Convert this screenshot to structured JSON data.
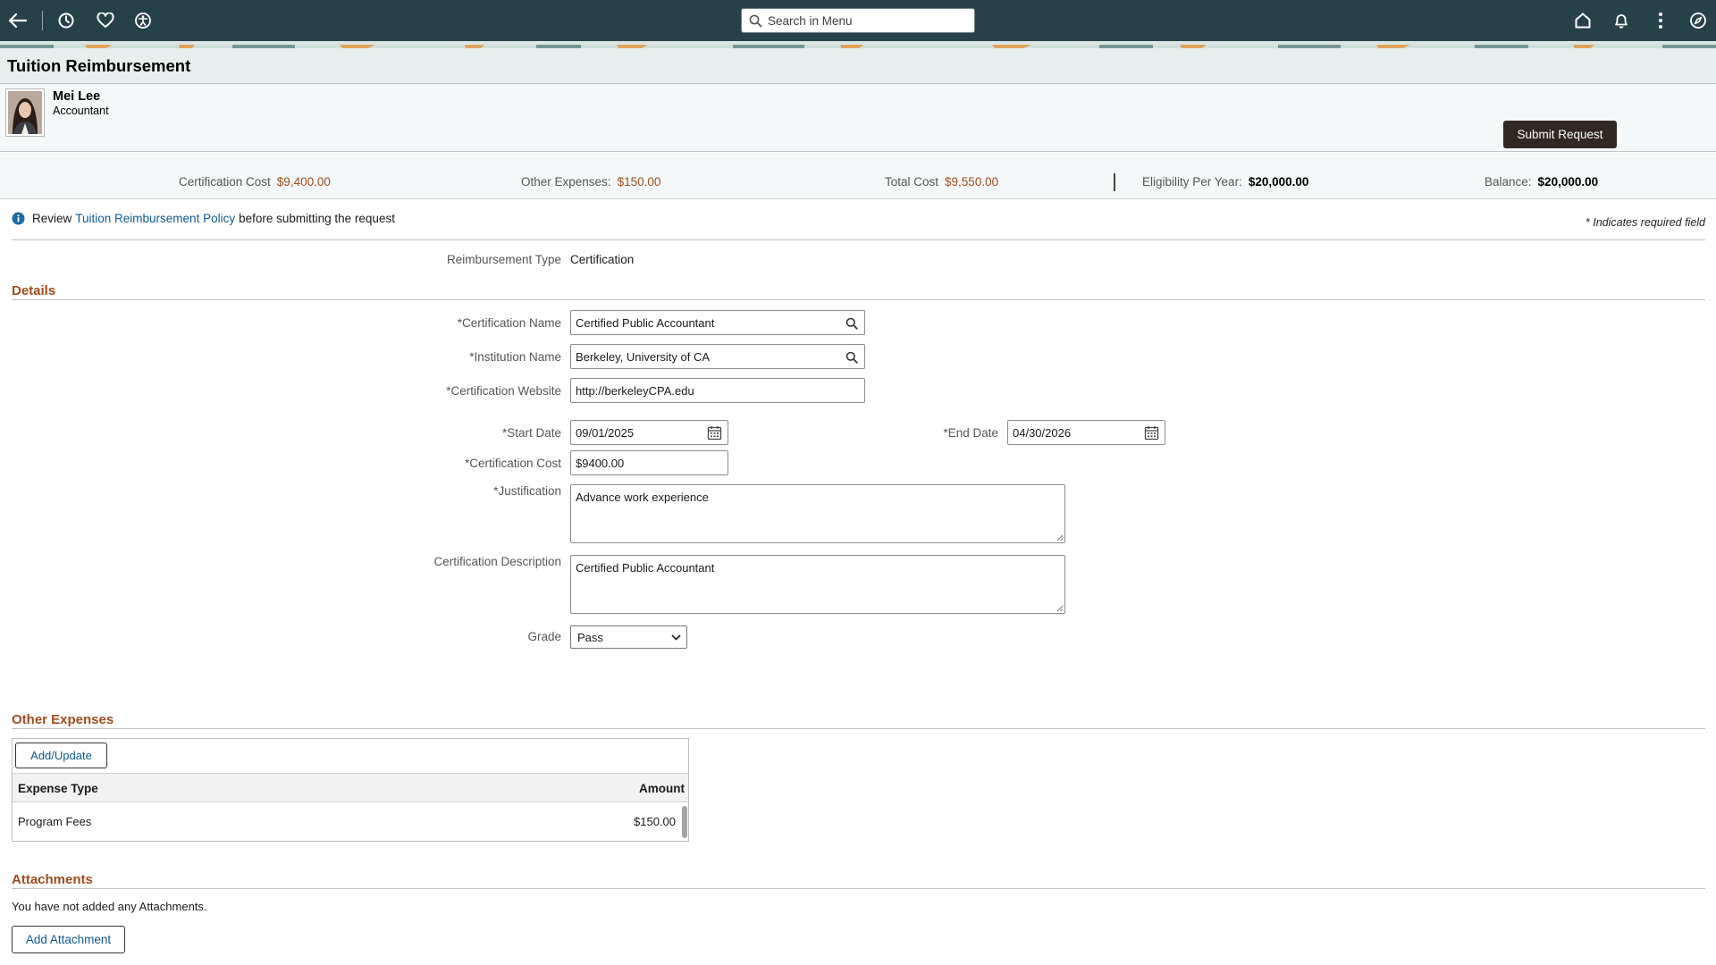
{
  "topbar": {
    "search_placeholder": "Search in Menu",
    "icons": [
      "back-arrow-icon",
      "history-icon",
      "heart-icon",
      "accessibility-icon",
      "home-icon",
      "bell-icon",
      "more-vertical-icon",
      "compass-icon"
    ]
  },
  "page": {
    "title": "Tuition Reimbursement"
  },
  "employee": {
    "name": "Mei Lee",
    "role": "Accountant"
  },
  "actions": {
    "submit_label": "Submit Request"
  },
  "summary": {
    "certification_cost": {
      "label": "Certification Cost",
      "value": "$9,400.00"
    },
    "other_expenses": {
      "label": "Other Expenses:",
      "value": "$150.00"
    },
    "total_cost": {
      "label": "Total Cost",
      "value": "$9,550.00"
    },
    "eligibility": {
      "label": "Eligibility Per Year:",
      "value": "$20,000.00"
    },
    "balance": {
      "label": "Balance:",
      "value": "$20,000.00"
    }
  },
  "info": {
    "prefix": "Review",
    "link": "Tuition Reimbursement Policy",
    "suffix": "before submitting the request",
    "required_note": "* Indicates required field"
  },
  "reimbursement_type": {
    "label": "Reimbursement Type",
    "value": "Certification"
  },
  "details": {
    "title": "Details",
    "certification_name": {
      "label": "*Certification Name",
      "value": "Certified Public Accountant"
    },
    "institution_name": {
      "label": "*Institution Name",
      "value": "Berkeley, University of CA"
    },
    "certification_website": {
      "label": "*Certification Website",
      "value": "http://berkeleyCPA.edu"
    },
    "start_date": {
      "label": "*Start Date",
      "value": "09/01/2025"
    },
    "end_date": {
      "label": "*End Date",
      "value": "04/30/2026"
    },
    "certification_cost": {
      "label": "*Certification Cost",
      "value": "$9400.00"
    },
    "justification": {
      "label": "*Justification",
      "value": "Advance work experience"
    },
    "certification_description": {
      "label": "Certification Description",
      "value": "Certified Public Accountant"
    },
    "grade": {
      "label": "Grade",
      "value": "Pass"
    }
  },
  "other_expenses": {
    "title": "Other Expenses",
    "add_update_label": "Add/Update",
    "columns": {
      "expense_type": "Expense Type",
      "amount": "Amount"
    },
    "rows": [
      {
        "expense_type": "Program Fees",
        "amount": "$150.00"
      }
    ]
  },
  "attachments": {
    "title": "Attachments",
    "empty_text": "You have not added any Attachments.",
    "add_label": "Add Attachment"
  },
  "colors": {
    "topbar": "#274148",
    "accent": "#a34b1f",
    "link": "#0f5a94",
    "primary_button": "#312921"
  }
}
